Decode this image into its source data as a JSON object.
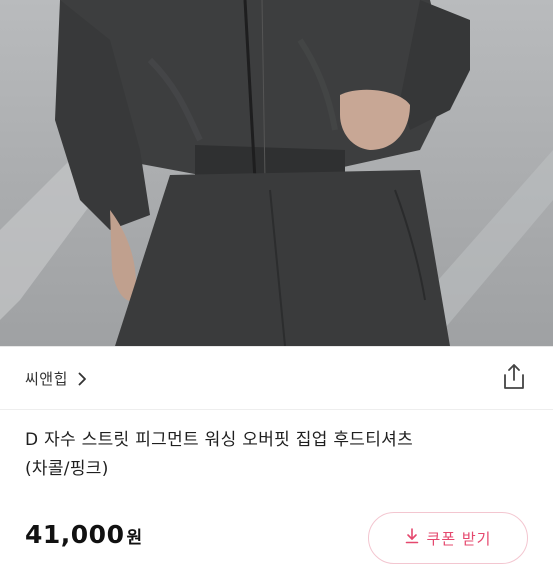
{
  "product_image": {
    "alt": "",
    "colors": {
      "garment": "#3a3b3c",
      "background": "#b1b3b5",
      "skin": "#c8a795"
    }
  },
  "store": {
    "name": "씨앤힙",
    "chevron_icon": "chevron-right-icon",
    "share_icon": "share-icon"
  },
  "product": {
    "title_line1": "D 자수 스트릿 피그먼트 워싱 오버핏 집업 후드티셔츠",
    "title_line2": "(차콜/핑크)",
    "price_number": "41,000",
    "price_unit": "원"
  },
  "coupon": {
    "label": "쿠폰 받기",
    "icon": "download-icon",
    "accent_color": "#e5486e",
    "border_color": "#f3c6d0"
  }
}
